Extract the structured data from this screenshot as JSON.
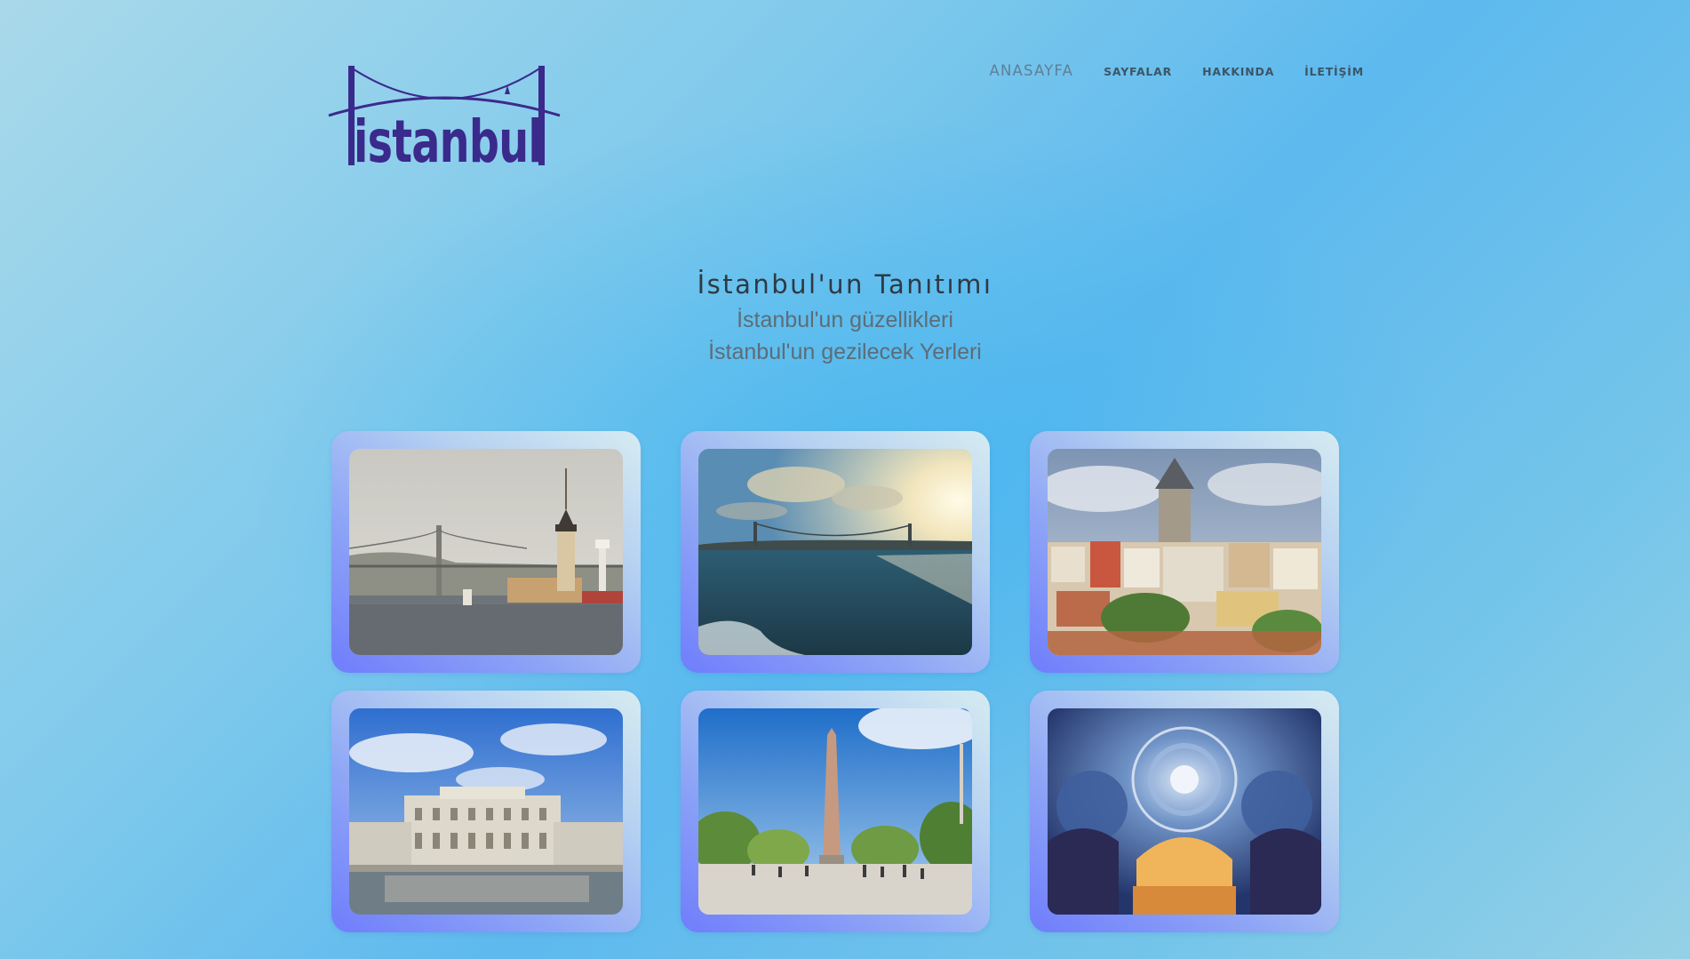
{
  "logo": {
    "text": "istanbul",
    "color": "#3a2a8c"
  },
  "nav": {
    "items": [
      {
        "label": "ANASAYFA"
      },
      {
        "label": "SAYFALAR"
      },
      {
        "label": "HAKKINDA"
      },
      {
        "label": "İLETİŞİM"
      }
    ]
  },
  "intro": {
    "title": "İstanbul'un Tanıtımı",
    "line1": "İstanbul'un güzellikleri",
    "line2": "İstanbul'un gezilecek Yerleri"
  },
  "gallery": {
    "photos": [
      {
        "subject": "Maiden's Tower and Bosphorus Bridge"
      },
      {
        "subject": "Bosphorus Bridge at sunset over the sea"
      },
      {
        "subject": "Galata Tower above the city"
      },
      {
        "subject": "Dolmabahçe Palace by the water"
      },
      {
        "subject": "Obelisk at Sultanahmet Square"
      },
      {
        "subject": "Blue Mosque interior dome"
      }
    ]
  }
}
